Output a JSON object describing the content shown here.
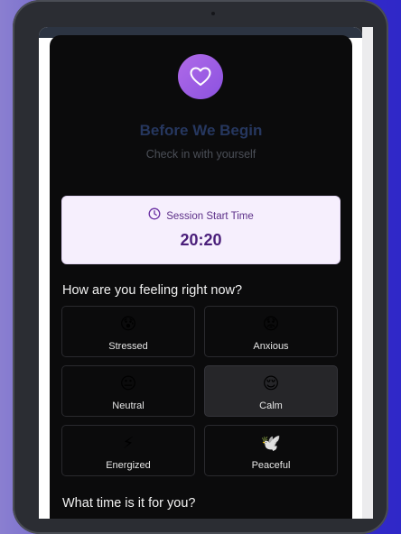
{
  "header": {
    "title": "Before We Begin",
    "subtitle": "Check in with yourself",
    "icon": "heart-icon"
  },
  "session": {
    "label": "Session Start Time",
    "time": "20:20",
    "icon": "clock-icon"
  },
  "mood_section": {
    "question": "How are you feeling right now?",
    "selected": "Calm",
    "options": [
      {
        "label": "Stressed",
        "emoji": "😰"
      },
      {
        "label": "Anxious",
        "emoji": "😟"
      },
      {
        "label": "Neutral",
        "emoji": "😐"
      },
      {
        "label": "Calm",
        "emoji": "😌"
      },
      {
        "label": "Energized",
        "emoji": "⚡"
      },
      {
        "label": "Peaceful",
        "emoji": "🕊️"
      }
    ]
  },
  "time_section": {
    "question": "What time is it for you?"
  },
  "colors": {
    "accent": "#8b52e0",
    "title": "#26375f",
    "card_bg": "#0b0b0c",
    "session_bg": "#f6effd"
  }
}
